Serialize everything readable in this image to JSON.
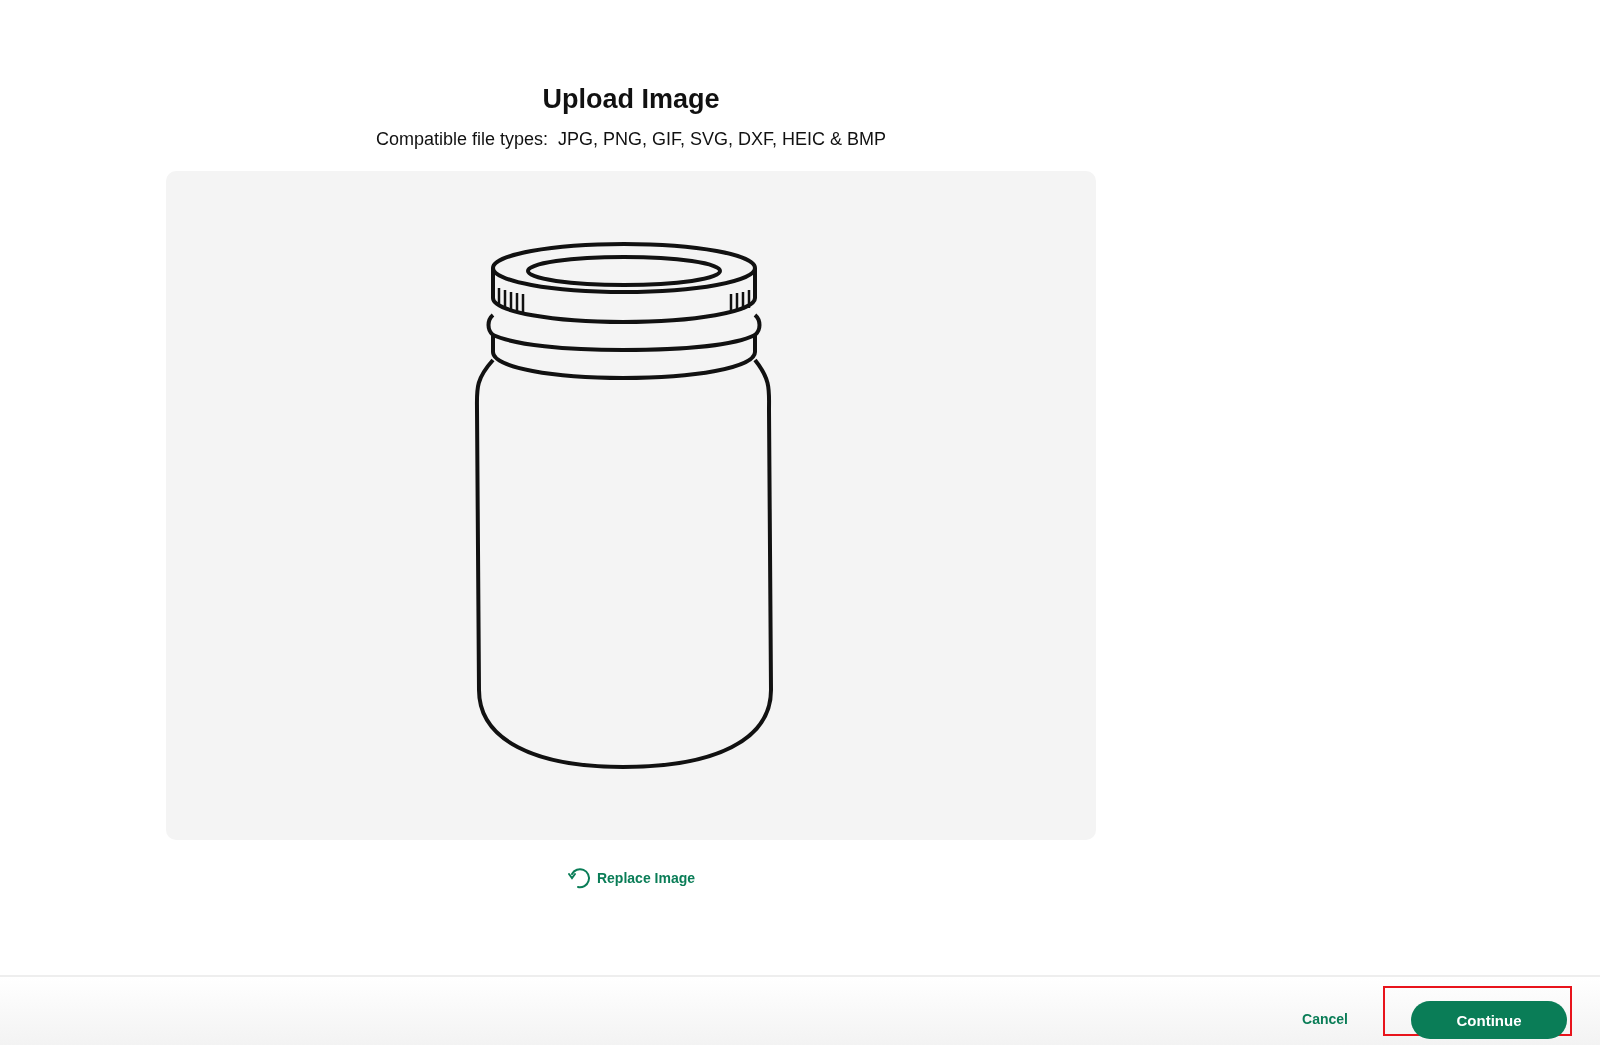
{
  "dialog": {
    "title": "Upload Image",
    "subtitle": "Compatible file types:  JPG, PNG, GIF, SVG, DXF, HEIC & BMP"
  },
  "replace_link": {
    "label": "Replace Image"
  },
  "footer": {
    "buttons": [
      {
        "label": "Cancel",
        "kind": "text",
        "highlighted": false
      },
      {
        "label": "Continue",
        "kind": "primary",
        "highlighted": true
      }
    ]
  }
}
